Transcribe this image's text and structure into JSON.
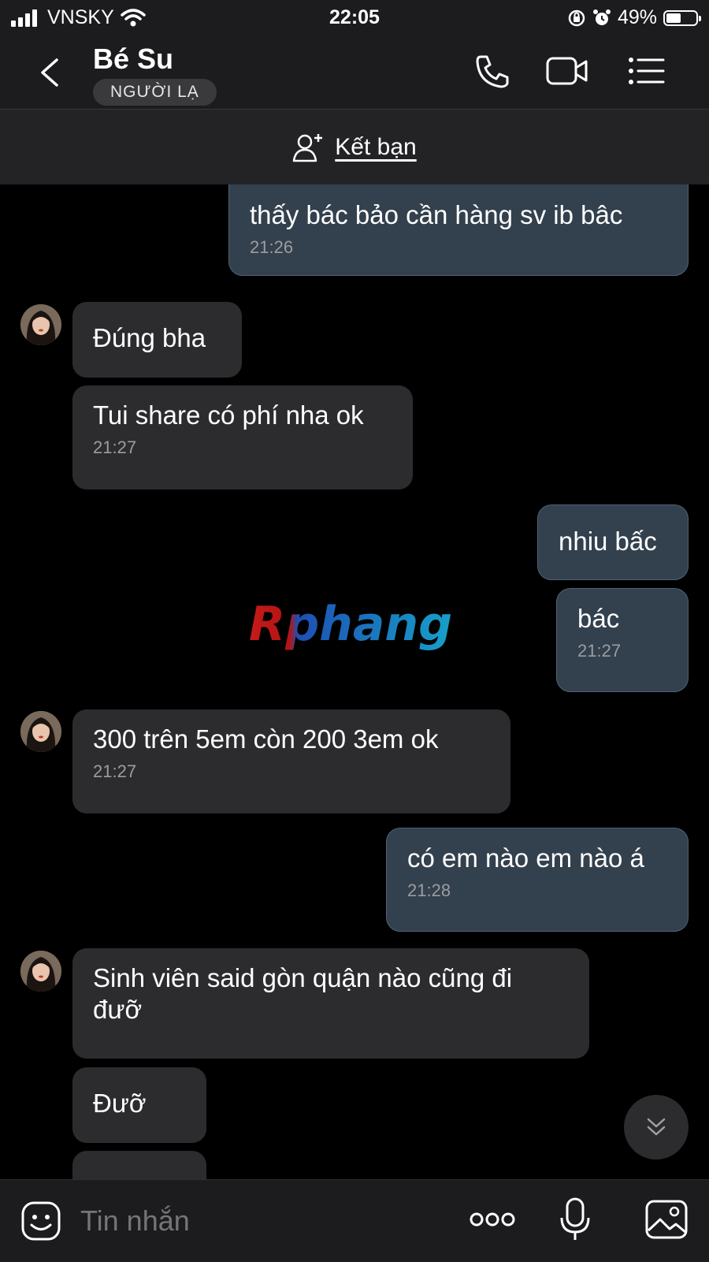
{
  "status_bar": {
    "carrier": "VNSKY",
    "time": "22:05",
    "battery": "49%",
    "battery_level": 0.49
  },
  "header": {
    "title": "Bé Su",
    "badge": "NGƯỜI LẠ"
  },
  "friend_bar": {
    "label": "Kết bạn"
  },
  "watermark": "Rphang",
  "messages": [
    {
      "side": "out",
      "text": "thấy bác bảo cần hàng sv ib bâc",
      "time": "21:26"
    },
    {
      "side": "in",
      "text": "Đúng bha",
      "time": ""
    },
    {
      "side": "in",
      "text": "Tui share có phí nha ok",
      "time": "21:27"
    },
    {
      "side": "out",
      "text": "nhiu bấc",
      "time": ""
    },
    {
      "side": "out",
      "text": "bác",
      "time": "21:27"
    },
    {
      "side": "in",
      "text": "300 trên 5em còn 200 3em ok",
      "time": "21:27"
    },
    {
      "side": "out",
      "text": "có em nào em nào á",
      "time": "21:28"
    },
    {
      "side": "in",
      "text": "Sinh viên said gòn quận nào cũng đi\nđưỡ",
      "time": ""
    },
    {
      "side": "in",
      "text": "Đưỡ",
      "time": ""
    },
    {
      "side": "in",
      "text": "",
      "time": ""
    }
  ],
  "input": {
    "placeholder": "Tin nhắn"
  },
  "icons": [
    "back-icon",
    "phone-icon",
    "video-call-icon",
    "menu-icon",
    "add-friend-icon",
    "emoji-icon",
    "more-icon",
    "mic-icon",
    "image-icon",
    "chevron-double-down-icon"
  ]
}
